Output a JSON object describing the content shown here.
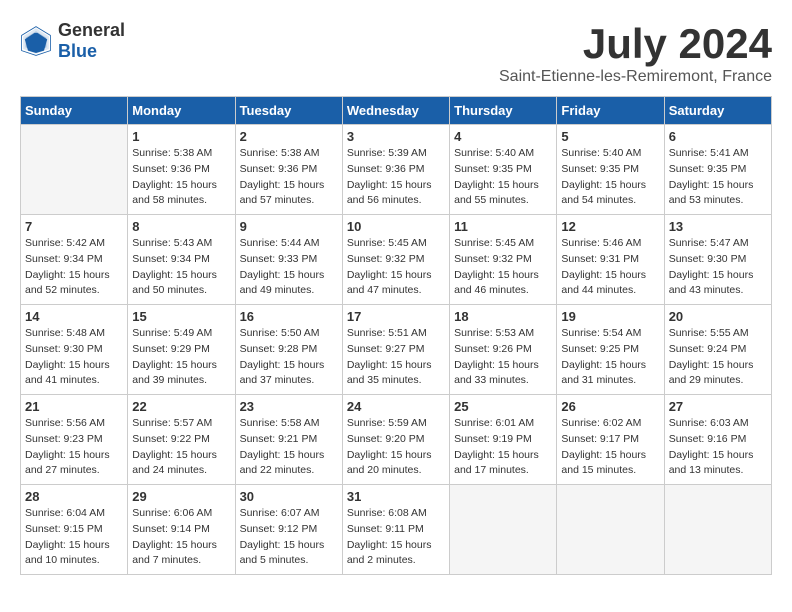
{
  "header": {
    "logo_general": "General",
    "logo_blue": "Blue",
    "month": "July 2024",
    "location": "Saint-Etienne-les-Remiremont, France"
  },
  "days_of_week": [
    "Sunday",
    "Monday",
    "Tuesday",
    "Wednesday",
    "Thursday",
    "Friday",
    "Saturday"
  ],
  "weeks": [
    [
      {
        "day": "",
        "empty": true
      },
      {
        "day": "1",
        "sunrise": "Sunrise: 5:38 AM",
        "sunset": "Sunset: 9:36 PM",
        "daylight": "Daylight: 15 hours and 58 minutes."
      },
      {
        "day": "2",
        "sunrise": "Sunrise: 5:38 AM",
        "sunset": "Sunset: 9:36 PM",
        "daylight": "Daylight: 15 hours and 57 minutes."
      },
      {
        "day": "3",
        "sunrise": "Sunrise: 5:39 AM",
        "sunset": "Sunset: 9:36 PM",
        "daylight": "Daylight: 15 hours and 56 minutes."
      },
      {
        "day": "4",
        "sunrise": "Sunrise: 5:40 AM",
        "sunset": "Sunset: 9:35 PM",
        "daylight": "Daylight: 15 hours and 55 minutes."
      },
      {
        "day": "5",
        "sunrise": "Sunrise: 5:40 AM",
        "sunset": "Sunset: 9:35 PM",
        "daylight": "Daylight: 15 hours and 54 minutes."
      },
      {
        "day": "6",
        "sunrise": "Sunrise: 5:41 AM",
        "sunset": "Sunset: 9:35 PM",
        "daylight": "Daylight: 15 hours and 53 minutes."
      }
    ],
    [
      {
        "day": "7",
        "sunrise": "Sunrise: 5:42 AM",
        "sunset": "Sunset: 9:34 PM",
        "daylight": "Daylight: 15 hours and 52 minutes."
      },
      {
        "day": "8",
        "sunrise": "Sunrise: 5:43 AM",
        "sunset": "Sunset: 9:34 PM",
        "daylight": "Daylight: 15 hours and 50 minutes."
      },
      {
        "day": "9",
        "sunrise": "Sunrise: 5:44 AM",
        "sunset": "Sunset: 9:33 PM",
        "daylight": "Daylight: 15 hours and 49 minutes."
      },
      {
        "day": "10",
        "sunrise": "Sunrise: 5:45 AM",
        "sunset": "Sunset: 9:32 PM",
        "daylight": "Daylight: 15 hours and 47 minutes."
      },
      {
        "day": "11",
        "sunrise": "Sunrise: 5:45 AM",
        "sunset": "Sunset: 9:32 PM",
        "daylight": "Daylight: 15 hours and 46 minutes."
      },
      {
        "day": "12",
        "sunrise": "Sunrise: 5:46 AM",
        "sunset": "Sunset: 9:31 PM",
        "daylight": "Daylight: 15 hours and 44 minutes."
      },
      {
        "day": "13",
        "sunrise": "Sunrise: 5:47 AM",
        "sunset": "Sunset: 9:30 PM",
        "daylight": "Daylight: 15 hours and 43 minutes."
      }
    ],
    [
      {
        "day": "14",
        "sunrise": "Sunrise: 5:48 AM",
        "sunset": "Sunset: 9:30 PM",
        "daylight": "Daylight: 15 hours and 41 minutes."
      },
      {
        "day": "15",
        "sunrise": "Sunrise: 5:49 AM",
        "sunset": "Sunset: 9:29 PM",
        "daylight": "Daylight: 15 hours and 39 minutes."
      },
      {
        "day": "16",
        "sunrise": "Sunrise: 5:50 AM",
        "sunset": "Sunset: 9:28 PM",
        "daylight": "Daylight: 15 hours and 37 minutes."
      },
      {
        "day": "17",
        "sunrise": "Sunrise: 5:51 AM",
        "sunset": "Sunset: 9:27 PM",
        "daylight": "Daylight: 15 hours and 35 minutes."
      },
      {
        "day": "18",
        "sunrise": "Sunrise: 5:53 AM",
        "sunset": "Sunset: 9:26 PM",
        "daylight": "Daylight: 15 hours and 33 minutes."
      },
      {
        "day": "19",
        "sunrise": "Sunrise: 5:54 AM",
        "sunset": "Sunset: 9:25 PM",
        "daylight": "Daylight: 15 hours and 31 minutes."
      },
      {
        "day": "20",
        "sunrise": "Sunrise: 5:55 AM",
        "sunset": "Sunset: 9:24 PM",
        "daylight": "Daylight: 15 hours and 29 minutes."
      }
    ],
    [
      {
        "day": "21",
        "sunrise": "Sunrise: 5:56 AM",
        "sunset": "Sunset: 9:23 PM",
        "daylight": "Daylight: 15 hours and 27 minutes."
      },
      {
        "day": "22",
        "sunrise": "Sunrise: 5:57 AM",
        "sunset": "Sunset: 9:22 PM",
        "daylight": "Daylight: 15 hours and 24 minutes."
      },
      {
        "day": "23",
        "sunrise": "Sunrise: 5:58 AM",
        "sunset": "Sunset: 9:21 PM",
        "daylight": "Daylight: 15 hours and 22 minutes."
      },
      {
        "day": "24",
        "sunrise": "Sunrise: 5:59 AM",
        "sunset": "Sunset: 9:20 PM",
        "daylight": "Daylight: 15 hours and 20 minutes."
      },
      {
        "day": "25",
        "sunrise": "Sunrise: 6:01 AM",
        "sunset": "Sunset: 9:19 PM",
        "daylight": "Daylight: 15 hours and 17 minutes."
      },
      {
        "day": "26",
        "sunrise": "Sunrise: 6:02 AM",
        "sunset": "Sunset: 9:17 PM",
        "daylight": "Daylight: 15 hours and 15 minutes."
      },
      {
        "day": "27",
        "sunrise": "Sunrise: 6:03 AM",
        "sunset": "Sunset: 9:16 PM",
        "daylight": "Daylight: 15 hours and 13 minutes."
      }
    ],
    [
      {
        "day": "28",
        "sunrise": "Sunrise: 6:04 AM",
        "sunset": "Sunset: 9:15 PM",
        "daylight": "Daylight: 15 hours and 10 minutes."
      },
      {
        "day": "29",
        "sunrise": "Sunrise: 6:06 AM",
        "sunset": "Sunset: 9:14 PM",
        "daylight": "Daylight: 15 hours and 7 minutes."
      },
      {
        "day": "30",
        "sunrise": "Sunrise: 6:07 AM",
        "sunset": "Sunset: 9:12 PM",
        "daylight": "Daylight: 15 hours and 5 minutes."
      },
      {
        "day": "31",
        "sunrise": "Sunrise: 6:08 AM",
        "sunset": "Sunset: 9:11 PM",
        "daylight": "Daylight: 15 hours and 2 minutes."
      },
      {
        "day": "",
        "empty": true
      },
      {
        "day": "",
        "empty": true
      },
      {
        "day": "",
        "empty": true
      }
    ]
  ]
}
